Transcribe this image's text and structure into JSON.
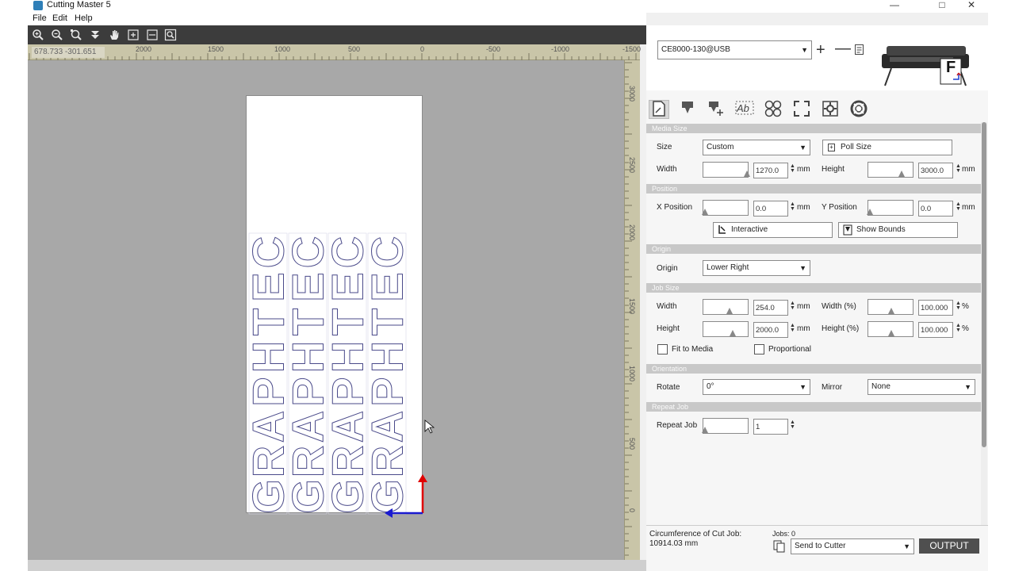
{
  "window": {
    "title": "Cutting Master 5",
    "minimize_icon": "minimize-icon",
    "maximize_icon": "maximize-icon",
    "close_icon": "close-icon"
  },
  "menu": {
    "items": [
      "File",
      "Edit",
      "Help"
    ]
  },
  "toolbar": {
    "icons": [
      "zoom-in-icon",
      "zoom-out-icon",
      "zoom-fit-icon",
      "move-down-icon",
      "pan-hand-icon",
      "fit-page-icon",
      "fit-width-icon",
      "zoom-search-icon"
    ]
  },
  "ruler": {
    "coordinate_readout": "678.733 -301.651",
    "h_labels": [
      "2000",
      "1500",
      "1000",
      "500",
      "0",
      "-500",
      "-1000",
      "-1500"
    ],
    "v_labels": [
      "3000",
      "2500",
      "2000",
      "1500",
      "1000",
      "500",
      "0"
    ]
  },
  "design": {
    "word": "GRAPHTEC",
    "letters": [
      "G",
      "R",
      "A",
      "P",
      "H",
      "T",
      "E",
      "C"
    ],
    "columns": 4
  },
  "device": {
    "selected": "CE8000-130@USB",
    "add_icon": "plus-icon",
    "remove_icon": "minus-icon",
    "properties_icon": "document-icon",
    "cutter_image": "cutter-image",
    "cutter_badge": "F"
  },
  "tabs": {
    "icons": [
      "page-setup-icon",
      "tool-icon",
      "tool-add-icon",
      "text-weld-icon",
      "panel-icon",
      "registration-marks-icon",
      "settings-icon",
      "help-lifebuoy-icon"
    ]
  },
  "media_size": {
    "header": "Media Size",
    "size_label": "Size",
    "size_value": "Custom",
    "poll_size_label": "Poll Size",
    "width_label": "Width",
    "width_value": "1270.0",
    "width_unit": "mm",
    "height_label": "Height",
    "height_value": "3000.0",
    "height_unit": "mm"
  },
  "position": {
    "header": "Position",
    "x_label": "X Position",
    "x_value": "0.0",
    "x_unit": "mm",
    "y_label": "Y Position",
    "y_value": "0.0",
    "y_unit": "mm",
    "interactive_label": "Interactive",
    "show_bounds_label": "Show Bounds"
  },
  "origin": {
    "header": "Origin",
    "label": "Origin",
    "value": "Lower Right"
  },
  "job_size": {
    "header": "Job Size",
    "width_label": "Width",
    "width_value": "254.0",
    "width_unit": "mm",
    "width_pct_label": "Width (%)",
    "width_pct_value": "100.000",
    "pct_unit": "%",
    "height_label": "Height",
    "height_value": "2000.0",
    "height_unit": "mm",
    "height_pct_label": "Height (%)",
    "height_pct_value": "100.000",
    "fit_to_media_label": "Fit to Media",
    "proportional_label": "Proportional"
  },
  "orientation": {
    "header": "Orientation",
    "rotate_label": "Rotate",
    "rotate_value": "0°",
    "mirror_label": "Mirror",
    "mirror_value": "None"
  },
  "repeat_job": {
    "header": "Repeat Job",
    "label": "Repeat Job",
    "value": "1"
  },
  "footer": {
    "circumference_label": "Circumference of Cut Job:",
    "circumference_value": "10914.03 mm",
    "jobs_label": "Jobs: 0",
    "send_value": "Send to Cutter",
    "output_label": "OUTPUT"
  }
}
